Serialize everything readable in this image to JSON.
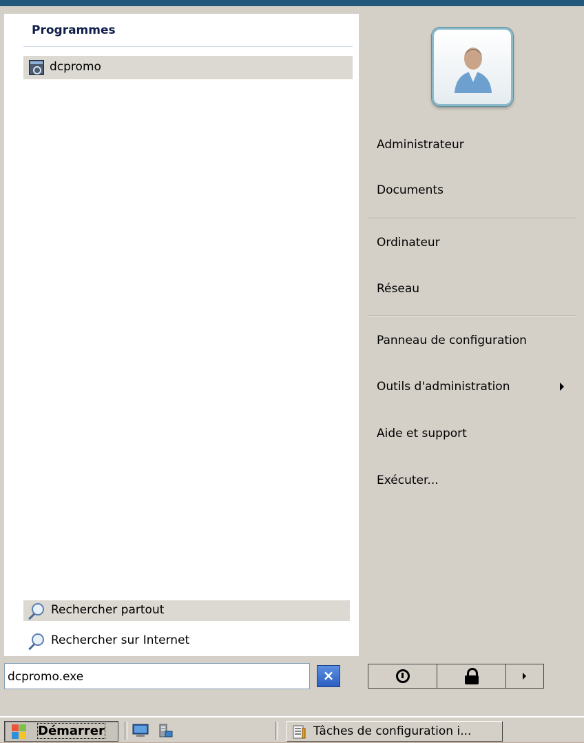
{
  "programs": {
    "title": "Programmes",
    "items": [
      {
        "label": "dcpromo",
        "icon": "application-icon"
      }
    ]
  },
  "search_links": [
    {
      "label": "Rechercher partout",
      "icon": "magnifier-icon"
    },
    {
      "label": "Rechercher sur Internet",
      "icon": "magnifier-icon"
    }
  ],
  "search": {
    "value": "dcpromo.exe",
    "clear_label": "×"
  },
  "right_pane": {
    "user": "Administrateur",
    "items": [
      "Documents",
      "Ordinateur",
      "Réseau",
      "Panneau de configuration",
      "Outils d'administration",
      "Aide et support",
      "Exécuter..."
    ]
  },
  "taskbar": {
    "start_label": "Démarrer",
    "task_label": "Tâches de configuration i..."
  },
  "colors": {
    "title_bar": "#22587a",
    "menu_bg": "#d4d0c8",
    "highlight": "#dcd8d2",
    "programs_title": "#0f1e4b"
  }
}
